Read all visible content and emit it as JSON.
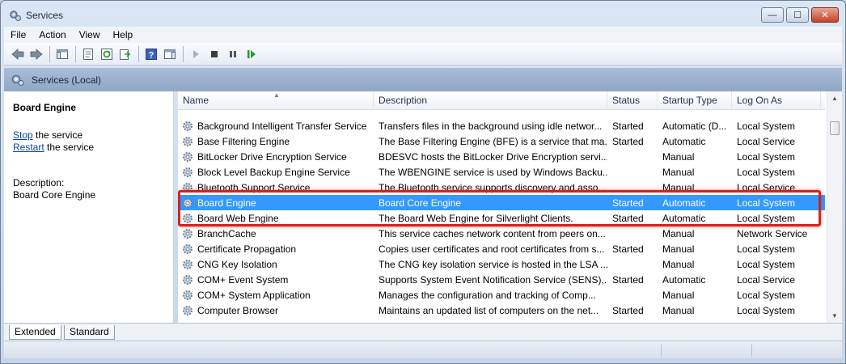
{
  "window": {
    "title": "Services",
    "minimize_label": "—",
    "maximize_label": "☐",
    "close_label": "✕"
  },
  "menu": [
    "File",
    "Action",
    "View",
    "Help"
  ],
  "toolbar": {
    "icons": [
      "back-arrow-icon",
      "forward-arrow-icon",
      "show-hide-console-tree-icon",
      "properties-icon",
      "refresh-icon",
      "export-list-icon",
      "help-icon",
      "show-action-pane-icon",
      "start-service-icon",
      "stop-service-icon",
      "pause-service-icon",
      "restart-service-icon"
    ]
  },
  "header": {
    "title": "Services (Local)"
  },
  "left_pane": {
    "service_title": "Board Engine",
    "stop_link": "Stop",
    "stop_suffix": " the service",
    "restart_link": "Restart",
    "restart_suffix": " the service",
    "description_label": "Description:",
    "description_text": "Board Core Engine"
  },
  "columns": [
    "Name",
    "Description",
    "Status",
    "Startup Type",
    "Log On As"
  ],
  "rows": [
    {
      "name": "Background Intelligent Transfer Service",
      "description": "Transfers files in the background using idle networ...",
      "status": "Started",
      "startup": "Automatic (D...",
      "logon": "Local System"
    },
    {
      "name": "Base Filtering Engine",
      "description": "The Base Filtering Engine (BFE) is a service that ma...",
      "status": "Started",
      "startup": "Automatic",
      "logon": "Local Service"
    },
    {
      "name": "BitLocker Drive Encryption Service",
      "description": "BDESVC hosts the BitLocker Drive Encryption servi...",
      "status": "",
      "startup": "Manual",
      "logon": "Local System"
    },
    {
      "name": "Block Level Backup Engine Service",
      "description": "The WBENGINE service is used by Windows Backu...",
      "status": "",
      "startup": "Manual",
      "logon": "Local System"
    },
    {
      "name": "Bluetooth Support Service",
      "description": "The Bluetooth service supports discovery and asso...",
      "status": "",
      "startup": "Manual",
      "logon": "Local Service"
    },
    {
      "name": "Board Engine",
      "description": "Board Core Engine",
      "status": "Started",
      "startup": "Automatic",
      "logon": "Local System",
      "selected": true
    },
    {
      "name": "Board Web Engine",
      "description": "The Board Web Engine for Silverlight Clients.",
      "status": "Started",
      "startup": "Automatic",
      "logon": "Local System"
    },
    {
      "name": "BranchCache",
      "description": "This service caches network content from peers on...",
      "status": "",
      "startup": "Manual",
      "logon": "Network Service"
    },
    {
      "name": "Certificate Propagation",
      "description": "Copies user certificates and root certificates from s...",
      "status": "Started",
      "startup": "Manual",
      "logon": "Local System"
    },
    {
      "name": "CNG Key Isolation",
      "description": "The CNG key isolation service is hosted in the LSA ...",
      "status": "",
      "startup": "Manual",
      "logon": "Local System"
    },
    {
      "name": "COM+ Event System",
      "description": "Supports System Event Notification Service (SENS),...",
      "status": "Started",
      "startup": "Automatic",
      "logon": "Local Service"
    },
    {
      "name": "COM+ System Application",
      "description": "Manages the configuration and tracking of Comp...",
      "status": "",
      "startup": "Manual",
      "logon": "Local System"
    },
    {
      "name": "Computer Browser",
      "description": "Maintains an updated list of computers on the net...",
      "status": "Started",
      "startup": "Manual",
      "logon": "Local System"
    }
  ],
  "tabs": [
    "Extended",
    "Standard"
  ]
}
